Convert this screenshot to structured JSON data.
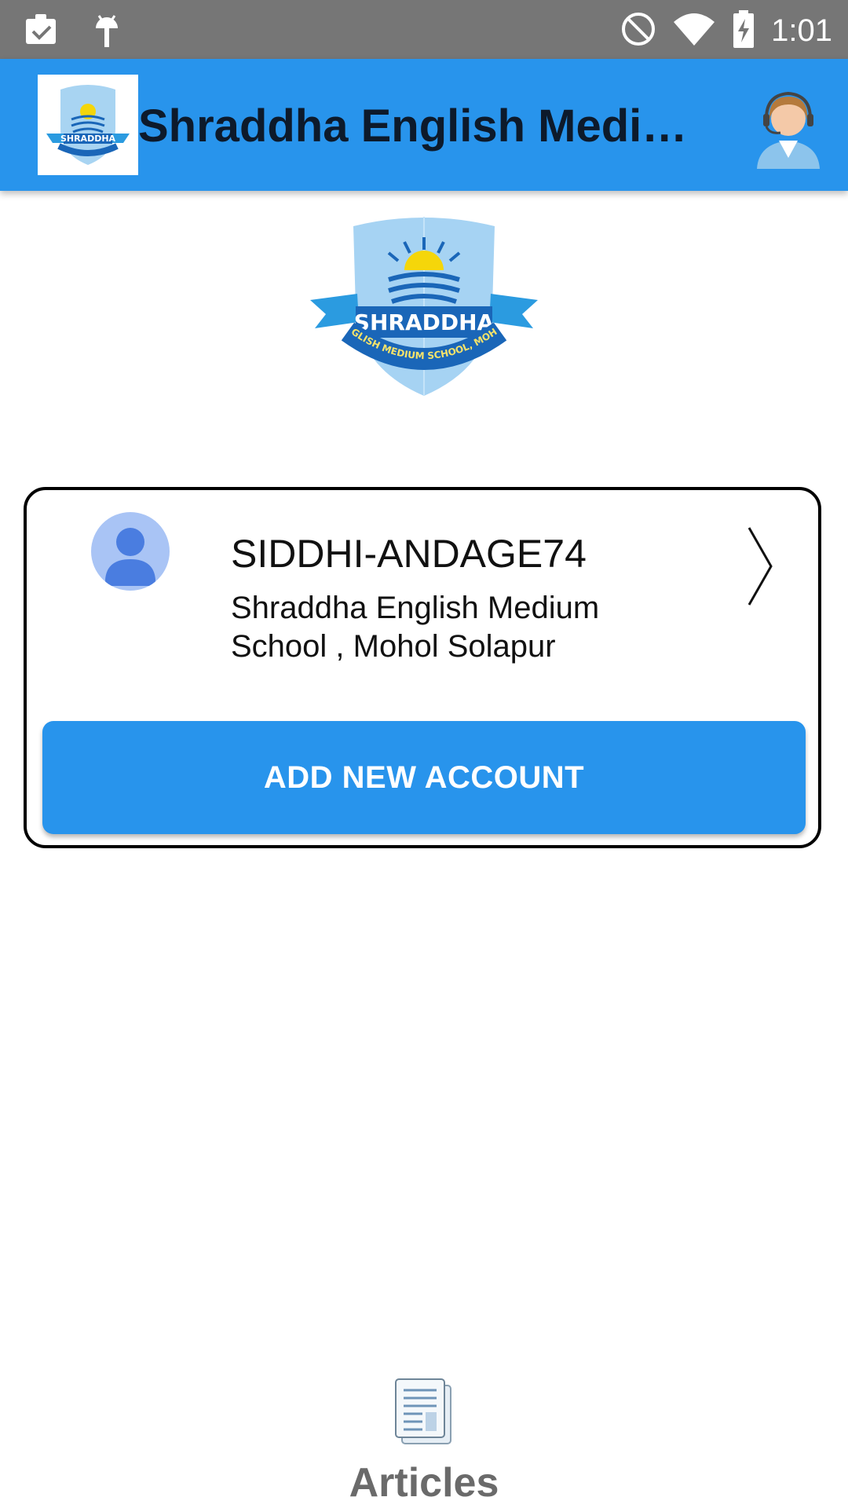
{
  "status_bar": {
    "time": "1:01",
    "icons": [
      "clipboard-check-icon",
      "android-icon",
      "do-not-disturb-icon",
      "wifi-icon",
      "battery-charging-icon"
    ]
  },
  "app_bar": {
    "title": "Shraddha English Medium School",
    "logo_icon": "school-logo-icon",
    "support_icon": "customer-support-icon"
  },
  "school_logo": {
    "name_text": "SHRADDHA",
    "banner_text": "ENGLISH MEDIUM SCHOOL, MOHOL"
  },
  "account": {
    "username": "SIDDHI-ANDAGE74",
    "school_line1": "Shraddha English Medium",
    "school_line2": "School , Mohol Solapur"
  },
  "add_account_label": "ADD NEW ACCOUNT",
  "bottom_nav": {
    "articles_label": "Articles"
  },
  "colors": {
    "primary": "#2894ec",
    "status_bar": "#767676",
    "avatar_bg": "#a9c4f5",
    "avatar_fg": "#4a7de0"
  }
}
